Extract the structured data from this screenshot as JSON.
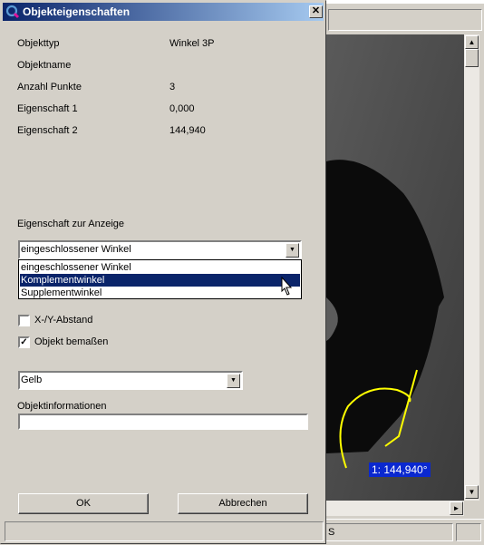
{
  "dialog": {
    "title": "Objekteigenschaften",
    "close_glyph": "✕",
    "properties": [
      {
        "label": "Objekttyp",
        "value": "Winkel 3P"
      },
      {
        "label": "Objektname",
        "value": ""
      },
      {
        "label": "Anzahl Punkte",
        "value": "3"
      },
      {
        "label": "Eigenschaft 1",
        "value": "0,000"
      },
      {
        "label": "Eigenschaft 2",
        "value": "144,940"
      }
    ],
    "display_property": {
      "label": "Eigenschaft zur Anzeige",
      "selected": "eingeschlossener Winkel",
      "options": [
        "eingeschlossener Winkel",
        "Komplementwinkel",
        "Supplementwinkel"
      ],
      "highlighted_index": 1
    },
    "xy_distance": {
      "label": "X-/Y-Abstand",
      "checked": false
    },
    "dimension_object": {
      "label": "Objekt bemaßen",
      "checked": true,
      "check_glyph": "✓"
    },
    "color_select": {
      "selected": "Gelb"
    },
    "object_info": {
      "label": "Objektinformationen",
      "value": ""
    },
    "ok_label": "OK",
    "cancel_label": "Abbrechen"
  },
  "canvas": {
    "measurement_label": "1: 144,940°",
    "annotation_color": "#ffff00"
  },
  "background_app": {
    "status_fragment": "S"
  },
  "icons": [
    "app-icon",
    "close-icon",
    "chevron-down-icon",
    "checkmark-icon",
    "mouse-cursor-icon",
    "scroll-up-icon",
    "scroll-down-icon",
    "scroll-right-icon"
  ]
}
